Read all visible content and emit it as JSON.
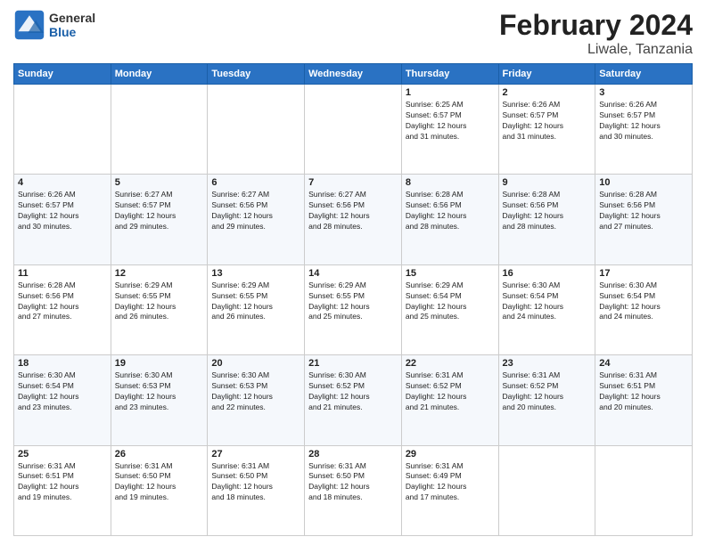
{
  "header": {
    "logo_general": "General",
    "logo_blue": "Blue",
    "month_title": "February 2024",
    "location": "Liwale, Tanzania"
  },
  "weekdays": [
    "Sunday",
    "Monday",
    "Tuesday",
    "Wednesday",
    "Thursday",
    "Friday",
    "Saturday"
  ],
  "weeks": [
    [
      {
        "day": "",
        "info": ""
      },
      {
        "day": "",
        "info": ""
      },
      {
        "day": "",
        "info": ""
      },
      {
        "day": "",
        "info": ""
      },
      {
        "day": "1",
        "info": "Sunrise: 6:25 AM\nSunset: 6:57 PM\nDaylight: 12 hours\nand 31 minutes."
      },
      {
        "day": "2",
        "info": "Sunrise: 6:26 AM\nSunset: 6:57 PM\nDaylight: 12 hours\nand 31 minutes."
      },
      {
        "day": "3",
        "info": "Sunrise: 6:26 AM\nSunset: 6:57 PM\nDaylight: 12 hours\nand 30 minutes."
      }
    ],
    [
      {
        "day": "4",
        "info": "Sunrise: 6:26 AM\nSunset: 6:57 PM\nDaylight: 12 hours\nand 30 minutes."
      },
      {
        "day": "5",
        "info": "Sunrise: 6:27 AM\nSunset: 6:57 PM\nDaylight: 12 hours\nand 29 minutes."
      },
      {
        "day": "6",
        "info": "Sunrise: 6:27 AM\nSunset: 6:56 PM\nDaylight: 12 hours\nand 29 minutes."
      },
      {
        "day": "7",
        "info": "Sunrise: 6:27 AM\nSunset: 6:56 PM\nDaylight: 12 hours\nand 28 minutes."
      },
      {
        "day": "8",
        "info": "Sunrise: 6:28 AM\nSunset: 6:56 PM\nDaylight: 12 hours\nand 28 minutes."
      },
      {
        "day": "9",
        "info": "Sunrise: 6:28 AM\nSunset: 6:56 PM\nDaylight: 12 hours\nand 28 minutes."
      },
      {
        "day": "10",
        "info": "Sunrise: 6:28 AM\nSunset: 6:56 PM\nDaylight: 12 hours\nand 27 minutes."
      }
    ],
    [
      {
        "day": "11",
        "info": "Sunrise: 6:28 AM\nSunset: 6:56 PM\nDaylight: 12 hours\nand 27 minutes."
      },
      {
        "day": "12",
        "info": "Sunrise: 6:29 AM\nSunset: 6:55 PM\nDaylight: 12 hours\nand 26 minutes."
      },
      {
        "day": "13",
        "info": "Sunrise: 6:29 AM\nSunset: 6:55 PM\nDaylight: 12 hours\nand 26 minutes."
      },
      {
        "day": "14",
        "info": "Sunrise: 6:29 AM\nSunset: 6:55 PM\nDaylight: 12 hours\nand 25 minutes."
      },
      {
        "day": "15",
        "info": "Sunrise: 6:29 AM\nSunset: 6:54 PM\nDaylight: 12 hours\nand 25 minutes."
      },
      {
        "day": "16",
        "info": "Sunrise: 6:30 AM\nSunset: 6:54 PM\nDaylight: 12 hours\nand 24 minutes."
      },
      {
        "day": "17",
        "info": "Sunrise: 6:30 AM\nSunset: 6:54 PM\nDaylight: 12 hours\nand 24 minutes."
      }
    ],
    [
      {
        "day": "18",
        "info": "Sunrise: 6:30 AM\nSunset: 6:54 PM\nDaylight: 12 hours\nand 23 minutes."
      },
      {
        "day": "19",
        "info": "Sunrise: 6:30 AM\nSunset: 6:53 PM\nDaylight: 12 hours\nand 23 minutes."
      },
      {
        "day": "20",
        "info": "Sunrise: 6:30 AM\nSunset: 6:53 PM\nDaylight: 12 hours\nand 22 minutes."
      },
      {
        "day": "21",
        "info": "Sunrise: 6:30 AM\nSunset: 6:52 PM\nDaylight: 12 hours\nand 21 minutes."
      },
      {
        "day": "22",
        "info": "Sunrise: 6:31 AM\nSunset: 6:52 PM\nDaylight: 12 hours\nand 21 minutes."
      },
      {
        "day": "23",
        "info": "Sunrise: 6:31 AM\nSunset: 6:52 PM\nDaylight: 12 hours\nand 20 minutes."
      },
      {
        "day": "24",
        "info": "Sunrise: 6:31 AM\nSunset: 6:51 PM\nDaylight: 12 hours\nand 20 minutes."
      }
    ],
    [
      {
        "day": "25",
        "info": "Sunrise: 6:31 AM\nSunset: 6:51 PM\nDaylight: 12 hours\nand 19 minutes."
      },
      {
        "day": "26",
        "info": "Sunrise: 6:31 AM\nSunset: 6:50 PM\nDaylight: 12 hours\nand 19 minutes."
      },
      {
        "day": "27",
        "info": "Sunrise: 6:31 AM\nSunset: 6:50 PM\nDaylight: 12 hours\nand 18 minutes."
      },
      {
        "day": "28",
        "info": "Sunrise: 6:31 AM\nSunset: 6:50 PM\nDaylight: 12 hours\nand 18 minutes."
      },
      {
        "day": "29",
        "info": "Sunrise: 6:31 AM\nSunset: 6:49 PM\nDaylight: 12 hours\nand 17 minutes."
      },
      {
        "day": "",
        "info": ""
      },
      {
        "day": "",
        "info": ""
      }
    ]
  ]
}
